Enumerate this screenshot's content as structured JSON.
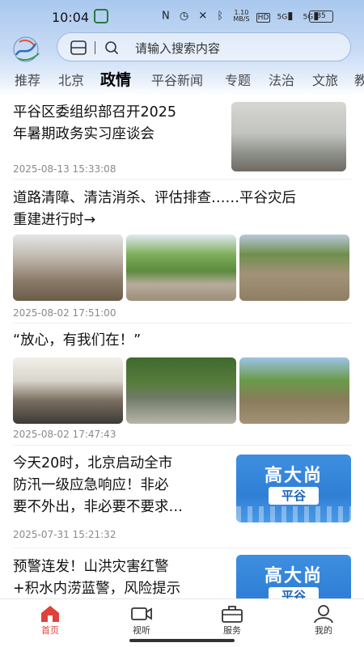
{
  "status": {
    "time": "10:04",
    "net_speed_top": "1.10",
    "net_speed_unit": "MB/S",
    "hd": "HD",
    "signal1": "5G",
    "signal2": "5G",
    "battery": "85"
  },
  "search": {
    "placeholder": "请输入搜索内容"
  },
  "tabs": [
    "推荐",
    "北京",
    "政情",
    "平谷新闻",
    "专题",
    "法治",
    "文旅",
    "教"
  ],
  "active_tab": "政情",
  "feed": [
    {
      "title_lines": [
        "平谷区委组织部召开2025",
        "年暑期政务实习座谈会"
      ],
      "date": "2025-08-13 15:33:08"
    },
    {
      "title_lines": [
        "道路清障、清洁消杀、评估排查……平谷灾后",
        "重建进行时→"
      ],
      "date": "2025-08-02 17:51:00"
    },
    {
      "title_lines": [
        "“放心，有我们在！”"
      ],
      "date": "2025-08-02 17:47:43"
    },
    {
      "title_lines": [
        "今天20时，北京启动全市",
        "防汛一级应急响应！非必",
        "要不外出，非必要不要求…"
      ],
      "date": "2025-07-31 15:21:32",
      "banner": {
        "big": "高大尚",
        "tag": "平谷"
      }
    },
    {
      "title_lines": [
        "预警连发！山洪灾害红警",
        "+积水内涝蓝警，风险提示"
      ],
      "banner": {
        "big": "高大尚",
        "tag": "平谷"
      }
    }
  ],
  "nav": [
    {
      "label": "首页",
      "icon": "home-icon",
      "active": true
    },
    {
      "label": "视听",
      "icon": "video-icon",
      "active": false
    },
    {
      "label": "服务",
      "icon": "briefcase-icon",
      "active": false
    },
    {
      "label": "我的",
      "icon": "profile-icon",
      "active": false
    }
  ],
  "colors": {
    "accent": "#e0413a",
    "header_blue": "#a9c8ee",
    "banner_blue": "#2f7fd6"
  }
}
